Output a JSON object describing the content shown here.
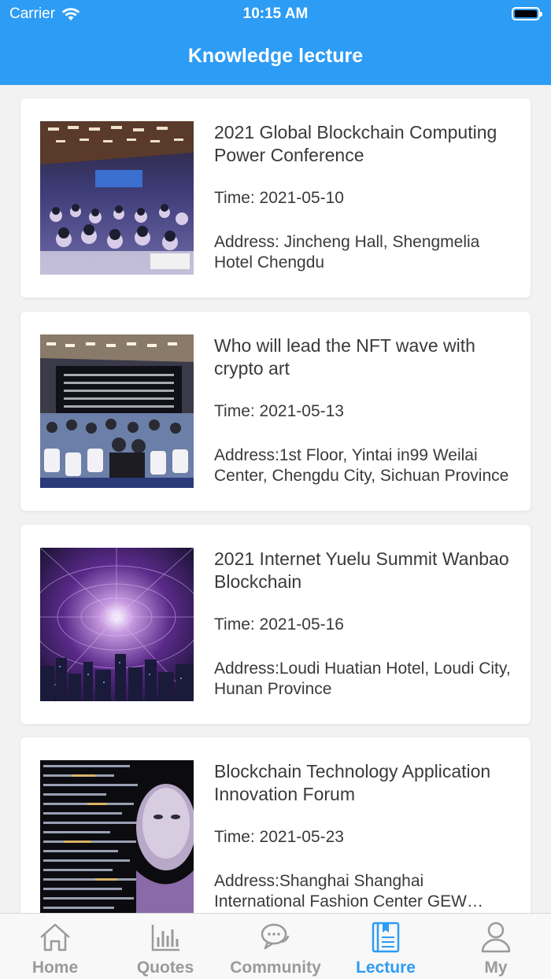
{
  "status_bar": {
    "carrier": "Carrier",
    "time": "10:15 AM"
  },
  "header": {
    "title": "Knowledge lecture"
  },
  "lectures": [
    {
      "title": "2021 Global Blockchain Computing Power Conference",
      "time": "Time: 2021-05-10",
      "address": "Address: Jincheng Hall, Shengmelia Hotel Chengdu"
    },
    {
      "title": "Who will lead the NFT wave with crypto art",
      "time": "Time: 2021-05-13",
      "address": "Address:1st Floor, Yintai in99 Weilai Center, Chengdu City, Sichuan Province"
    },
    {
      "title": "2021 Internet Yuelu Summit Wanbao Blockchain",
      "time": "Time: 2021-05-16",
      "address": "Address:Loudi Huatian Hotel, Loudi City, Hunan Province"
    },
    {
      "title": "Blockchain Technology Application Innovation Forum",
      "time": "Time: 2021-05-23",
      "address": "Address:Shanghai Shanghai International Fashion Center GEW Building"
    }
  ],
  "tabbar": {
    "items": [
      {
        "label": "Home",
        "icon": "home-icon"
      },
      {
        "label": "Quotes",
        "icon": "chart-icon"
      },
      {
        "label": "Community",
        "icon": "chat-icon"
      },
      {
        "label": "Lecture",
        "icon": "book-icon",
        "active": true
      },
      {
        "label": "My",
        "icon": "person-icon"
      }
    ]
  },
  "colors": {
    "accent": "#2d9cf5",
    "inactive": "#9a9a9a"
  }
}
